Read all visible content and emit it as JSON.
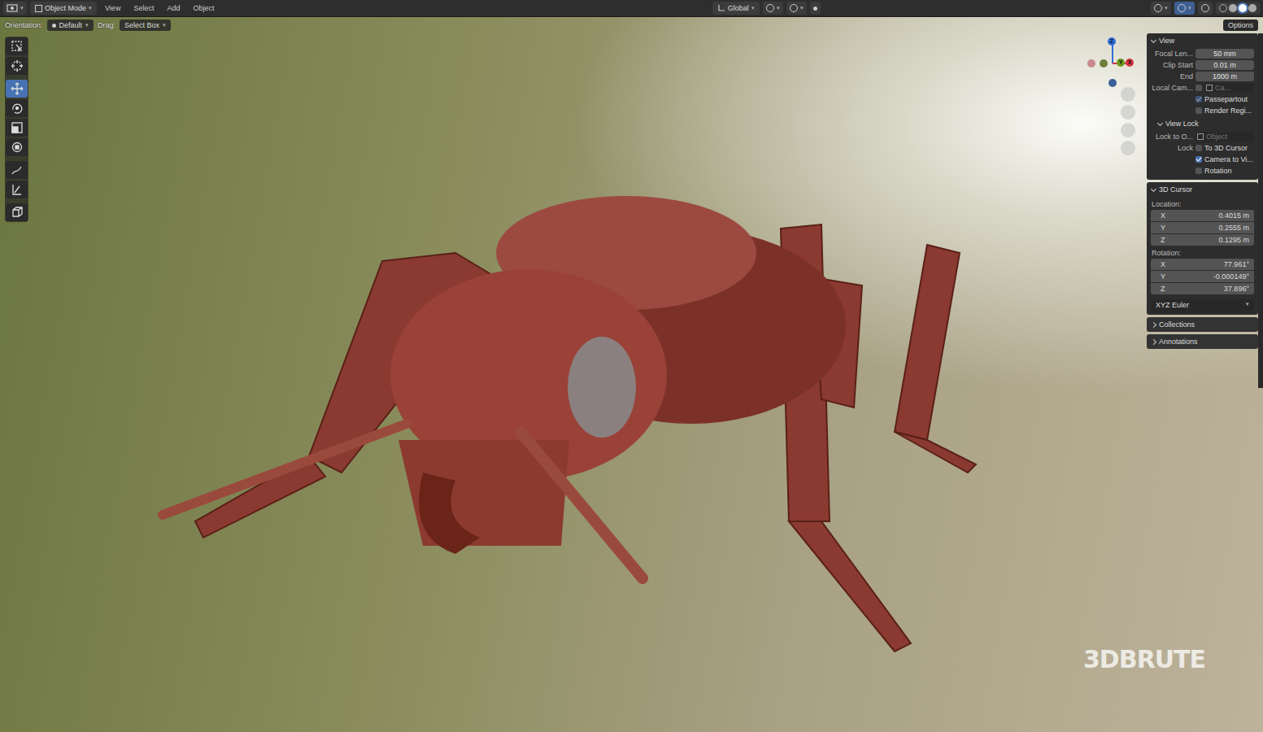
{
  "header": {
    "mode": "Object Mode",
    "menus": [
      "View",
      "Select",
      "Add",
      "Object"
    ],
    "transform": "Global"
  },
  "tool_header": {
    "orientation_label": "Orientation:",
    "orientation": "Default",
    "drag_label": "Drag:",
    "drag": "Select Box",
    "options": "Options"
  },
  "toolbar": {
    "tools": [
      {
        "selected": false
      },
      {
        "selected": false
      },
      {
        "selected": true
      },
      {
        "selected": false
      },
      {
        "selected": false
      },
      {
        "selected": false
      },
      {
        "selected": false
      },
      {
        "selected": false
      },
      {
        "selected": false
      }
    ]
  },
  "gizmo": {
    "axes": [
      "Z",
      "Y",
      "X"
    ]
  },
  "sidebar": {
    "view": {
      "title": "View",
      "expanded": true,
      "rows": [
        {
          "kind": "field",
          "label": "Focal Len...",
          "value": "50 mm"
        },
        {
          "kind": "field",
          "label": "Clip Start",
          "value": "0.01 m"
        },
        {
          "kind": "field",
          "label": "End",
          "value": "1000 m"
        },
        {
          "kind": "camera",
          "label": "Local Cam...",
          "checked": false,
          "value": "Ca..."
        },
        {
          "kind": "check",
          "label": "Passepartout",
          "checked": true,
          "disabled": true
        },
        {
          "kind": "check",
          "label": "Render Regi...",
          "checked": false,
          "disabled": false
        }
      ]
    },
    "view_lock": {
      "title": "View Lock",
      "expanded": true,
      "lock_to_label": "Lock to O...",
      "lock_to_placeholder": "Object",
      "lock_label": "Lock",
      "checks": [
        {
          "label": "To 3D Cursor",
          "checked": false
        },
        {
          "label": "Camera to Vi...",
          "checked": true
        },
        {
          "label": "Rotation",
          "checked": false
        }
      ]
    },
    "cursor": {
      "title": "3D Cursor",
      "expanded": true,
      "location_label": "Location:",
      "location": [
        {
          "axis": "X",
          "value": "0.4015 m"
        },
        {
          "axis": "Y",
          "value": "0.2555 m"
        },
        {
          "axis": "Z",
          "value": "0.1295 m"
        }
      ],
      "rotation_label": "Rotation:",
      "rotation": [
        {
          "axis": "X",
          "value": "77.961°"
        },
        {
          "axis": "Y",
          "value": "-0.000149°"
        },
        {
          "axis": "Z",
          "value": "37.896°"
        }
      ],
      "mode": "XYZ Euler"
    },
    "collapsed": [
      {
        "title": "Collections",
        "expanded": false
      },
      {
        "title": "Annotations",
        "expanded": false
      }
    ]
  },
  "watermark": "3DBRUTE"
}
